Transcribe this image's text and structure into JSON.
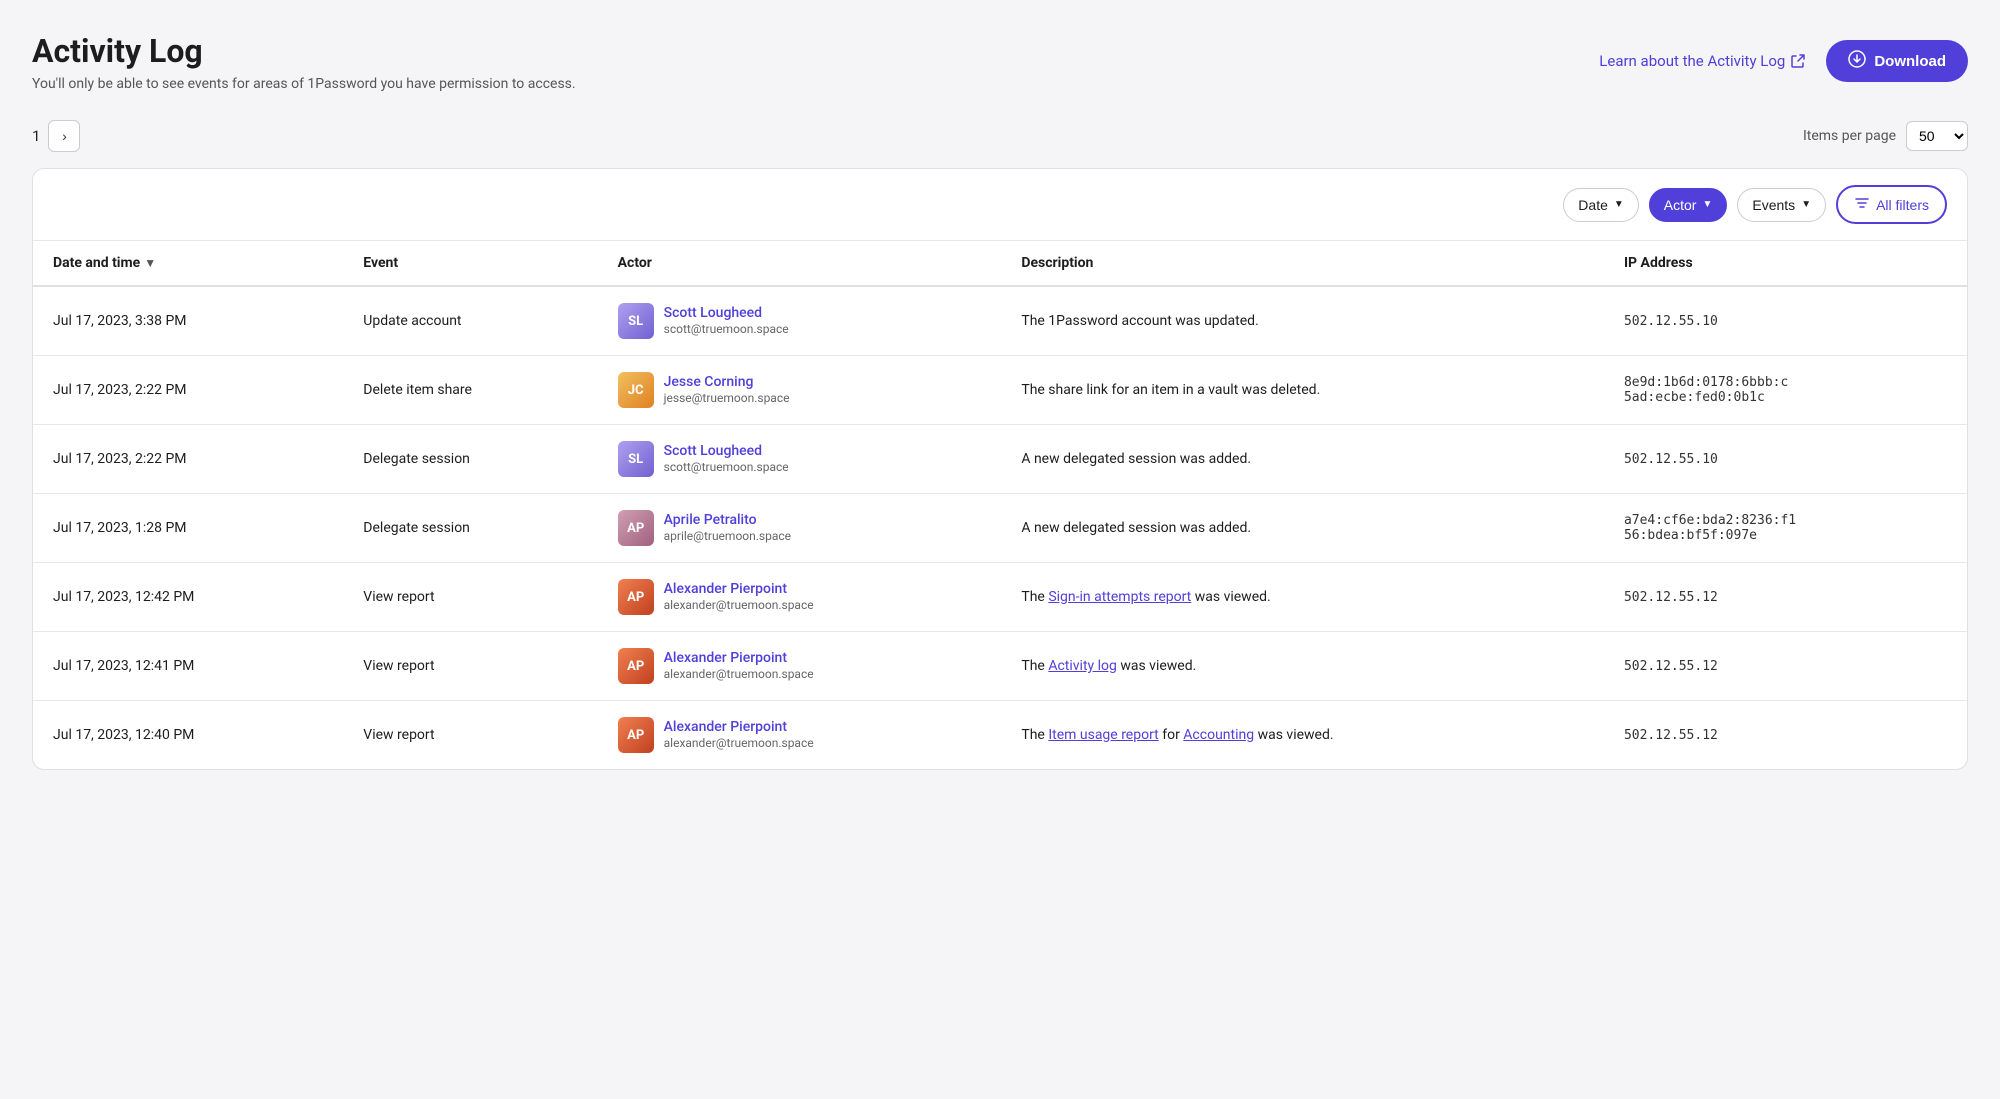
{
  "page": {
    "title": "Activity Log",
    "subtitle": "You'll only be able to see events for areas of 1Password you have permission to access."
  },
  "header": {
    "learn_label": "Learn about the Activity Log",
    "download_label": "Download"
  },
  "pagination": {
    "current_page": "1",
    "items_per_page_label": "Items per page",
    "items_per_page_value": "50",
    "next_btn_label": "›"
  },
  "filters": {
    "date_label": "Date",
    "actor_label": "Actor",
    "events_label": "Events",
    "all_filters_label": "All filters"
  },
  "table": {
    "columns": {
      "date_time": "Date and time",
      "event": "Event",
      "actor": "Actor",
      "description": "Description",
      "ip_address": "IP Address"
    },
    "rows": [
      {
        "id": 1,
        "date_time": "Jul 17, 2023, 3:38 PM",
        "event": "Update account",
        "actor_name": "Scott Lougheed",
        "actor_email": "scott@truemoon.space",
        "actor_avatar": "scott",
        "actor_initials": "SL",
        "description_text": "The 1Password account was updated.",
        "description_parts": null,
        "ip": "502.12.55.10"
      },
      {
        "id": 2,
        "date_time": "Jul 17, 2023, 2:22 PM",
        "event": "Delete item share",
        "actor_name": "Jesse Corning",
        "actor_email": "jesse@truemoon.space",
        "actor_avatar": "jesse",
        "actor_initials": "JC",
        "description_text": "The share link for an item in a vault was deleted.",
        "description_parts": null,
        "ip": "8e9d:1b6d:0178:6bbb:c\n5ad:ecbe:fed0:0b1c"
      },
      {
        "id": 3,
        "date_time": "Jul 17, 2023, 2:22 PM",
        "event": "Delegate session",
        "actor_name": "Scott Lougheed",
        "actor_email": "scott@truemoon.space",
        "actor_avatar": "scott",
        "actor_initials": "SL",
        "description_text": "A new delegated session was added.",
        "description_parts": null,
        "ip": "502.12.55.10"
      },
      {
        "id": 4,
        "date_time": "Jul 17, 2023, 1:28 PM",
        "event": "Delegate session",
        "actor_name": "Aprile Petralito",
        "actor_email": "aprile@truemoon.space",
        "actor_avatar": "aprile",
        "actor_initials": "AP",
        "description_text": "A new delegated session was added.",
        "description_parts": null,
        "ip": "a7e4:cf6e:bda2:8236:f1\n56:bdea:bf5f:097e"
      },
      {
        "id": 5,
        "date_time": "Jul 17, 2023, 12:42 PM",
        "event": "View report",
        "actor_name": "Alexander Pierpoint",
        "actor_email": "alexander@truemoon.space",
        "actor_avatar": "alexander",
        "actor_initials": "AP",
        "description_before": "The ",
        "description_link": "Sign-in attempts report",
        "description_after": " was viewed.",
        "ip": "502.12.55.12"
      },
      {
        "id": 6,
        "date_time": "Jul 17, 2023, 12:41 PM",
        "event": "View report",
        "actor_name": "Alexander Pierpoint",
        "actor_email": "alexander@truemoon.space",
        "actor_avatar": "alexander",
        "actor_initials": "AP",
        "description_before": "The ",
        "description_link": "Activity log",
        "description_after": " was viewed.",
        "ip": "502.12.55.12"
      },
      {
        "id": 7,
        "date_time": "Jul 17, 2023, 12:40 PM",
        "event": "View report",
        "actor_name": "Alexander Pierpoint",
        "actor_email": "alexander@truemoon.space",
        "actor_avatar": "alexander",
        "actor_initials": "AP",
        "description_before2": "The ",
        "description_link2": "Item usage report",
        "description_middle": " for ",
        "description_link3": "Accounting",
        "description_after2": " was viewed.",
        "ip": "502.12.55.12"
      }
    ]
  }
}
